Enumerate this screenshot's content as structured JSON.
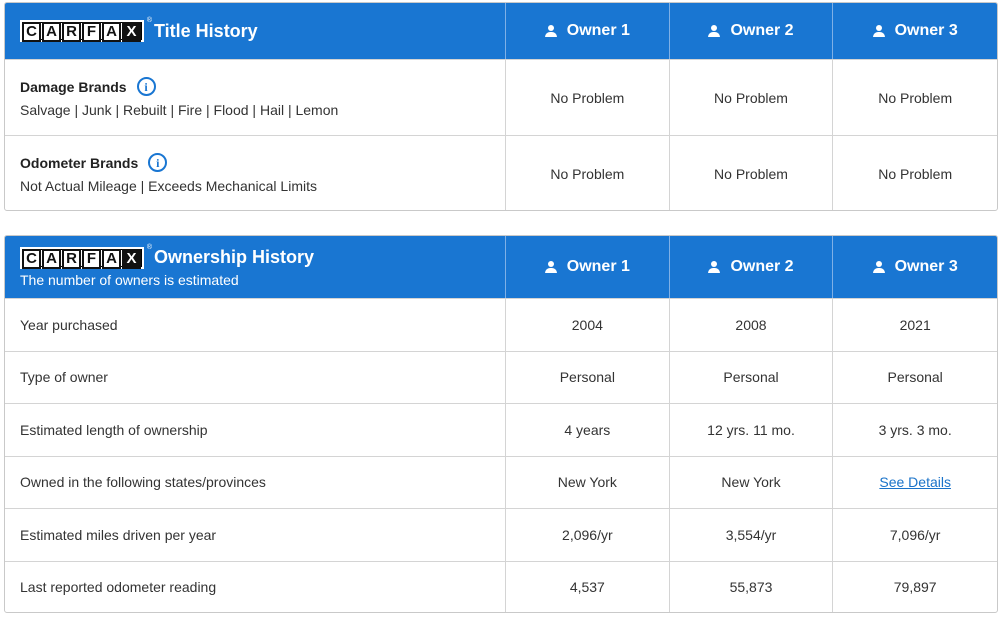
{
  "logo_letters": [
    "C",
    "A",
    "R",
    "F",
    "A",
    "X"
  ],
  "title_history": {
    "title": "Title History",
    "owners": [
      "Owner 1",
      "Owner 2",
      "Owner 3"
    ],
    "rows": [
      {
        "label": "Damage Brands",
        "detail": "Salvage | Junk | Rebuilt | Fire | Flood | Hail | Lemon",
        "values": [
          "No Problem",
          "No Problem",
          "No Problem"
        ]
      },
      {
        "label": "Odometer Brands",
        "detail": "Not Actual Mileage | Exceeds Mechanical Limits",
        "values": [
          "No Problem",
          "No Problem",
          "No Problem"
        ]
      }
    ]
  },
  "ownership_history": {
    "title": "Ownership History",
    "subtitle": "The number of owners is estimated",
    "owners": [
      "Owner 1",
      "Owner 2",
      "Owner 3"
    ],
    "rows": [
      {
        "label": "Year purchased",
        "values": [
          "2004",
          "2008",
          "2021"
        ]
      },
      {
        "label": "Type of owner",
        "values": [
          "Personal",
          "Personal",
          "Personal"
        ]
      },
      {
        "label": "Estimated length of ownership",
        "values": [
          "4 years",
          "12 yrs. 11 mo.",
          "3 yrs. 3 mo."
        ]
      },
      {
        "label": "Owned in the following states/provinces",
        "values": [
          "New York",
          "New York",
          "See Details"
        ]
      },
      {
        "label": "Estimated miles driven per year",
        "values": [
          "2,096/yr",
          "3,554/yr",
          "7,096/yr"
        ]
      },
      {
        "label": "Last reported odometer reading",
        "values": [
          "4,537",
          "55,873",
          "79,897"
        ]
      }
    ]
  },
  "colors": {
    "header_blue": "#1976d2",
    "link_blue": "#1a73c9"
  },
  "icons": {
    "owner": "person-icon",
    "info": "info-icon"
  }
}
